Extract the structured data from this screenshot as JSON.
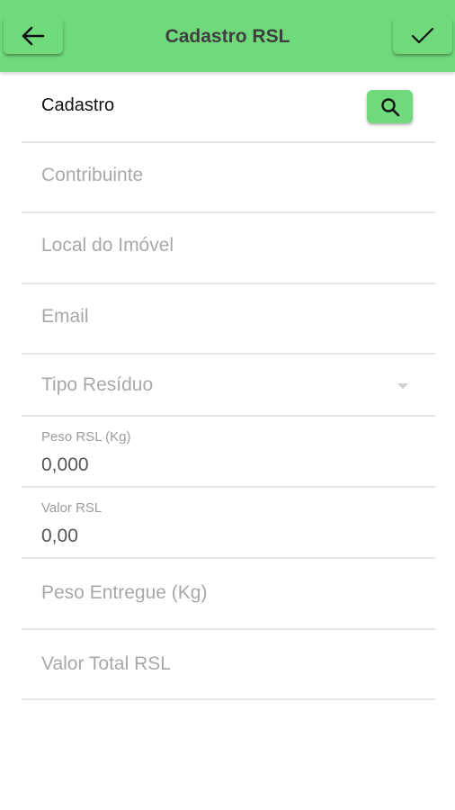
{
  "header": {
    "title": "Cadastro RSL",
    "back_icon": "arrow-left-icon",
    "confirm_icon": "check-icon",
    "color": "#6fd97b"
  },
  "form": {
    "cadastro_label": "Cadastro",
    "search_icon": "search-icon",
    "contribuinte_placeholder": "Contribuinte",
    "local_placeholder": "Local do Imóvel",
    "email_placeholder": "Email",
    "tipo_residuo_placeholder": "Tipo Resíduo",
    "peso_rsl_label": "Peso RSL (Kg)",
    "peso_rsl_value": "0,000",
    "valor_rsl_label": "Valor RSL",
    "valor_rsl_value": "0,00",
    "peso_entregue_placeholder": "Peso Entregue (Kg)",
    "valor_total_placeholder": "Valor Total RSL"
  }
}
